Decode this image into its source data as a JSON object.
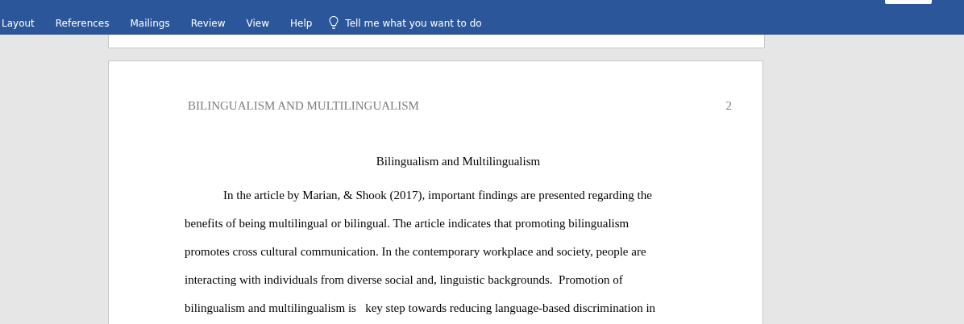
{
  "ribbon": {
    "tabs": [
      {
        "label": "Layout",
        "selected": false
      },
      {
        "label": "References",
        "selected": false
      },
      {
        "label": "Mailings",
        "selected": false
      },
      {
        "label": "Review",
        "selected": false
      },
      {
        "label": "View",
        "selected": false
      },
      {
        "label": "Help",
        "selected": false
      }
    ],
    "tell_me": {
      "placeholder": "Tell me what you want to do"
    }
  },
  "page": {
    "header": "BILINGUALISM AND MULTILINGUALISM",
    "page_number": "2",
    "title": "Bilingualism and Multilingualism",
    "lines": [
      "In the article by Marian, & Shook (2017), important findings are presented regarding the",
      "benefits of being multilingual or bilingual. The article indicates that promoting bilingualism",
      "promotes cross cultural communication. In the contemporary workplace and society, people are",
      "interacting with individuals from diverse social and, linguistic backgrounds.  Promotion of",
      "bilingualism and multilingualism is   key step towards reducing language-based discrimination in"
    ]
  }
}
